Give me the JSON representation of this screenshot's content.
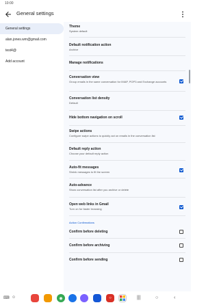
{
  "status_bar": {
    "time": "10:00"
  },
  "app_bar": {
    "title": "General settings"
  },
  "left_pane": {
    "items": [
      {
        "label": "General settings",
        "selected": true
      },
      {
        "label": "alan.jones.wm@gmail.com",
        "selected": false
      },
      {
        "label": "test4@",
        "selected": false
      },
      {
        "label": "Add account",
        "selected": false
      }
    ]
  },
  "settings": {
    "theme": {
      "title": "Theme",
      "sub": "System default"
    },
    "default_notification_action": {
      "title": "Default notification action",
      "sub": "Archive"
    },
    "manage_notifications": {
      "title": "Manage notifications"
    },
    "conversation_view": {
      "title": "Conversation view",
      "sub": "Group emails in the same conversation for IMAP, POP3 and Exchange accounts",
      "checked": true
    },
    "conversation_list_density": {
      "title": "Conversation list density",
      "sub": "Default"
    },
    "hide_bottom_navigation": {
      "title": "Hide bottom navigation on scroll",
      "checked": true
    },
    "swipe_actions": {
      "title": "Swipe actions",
      "sub": "Configure swipe actions to quickly act on emails in the conversation list"
    },
    "default_reply_action": {
      "title": "Default reply action",
      "sub": "Choose your default reply action"
    },
    "auto_fit_messages": {
      "title": "Auto-fit messages",
      "sub": "Shrink messages to fit the screen",
      "checked": true
    },
    "auto_advance": {
      "title": "Auto-advance",
      "sub": "Show conversation list after you archive or delete"
    },
    "open_web_links": {
      "title": "Open web links in Gmail",
      "sub": "Turn on for faster browsing",
      "checked": true
    },
    "section_action_confirmations": "Action Confirmations",
    "confirm_before_deleting": {
      "title": "Confirm before deleting",
      "checked": false
    },
    "confirm_before_archiving": {
      "title": "Confirm before archiving",
      "checked": false
    },
    "confirm_before_sending": {
      "title": "Confirm before sending",
      "checked": false
    }
  },
  "dock": {
    "icons": [
      "phone-app-icon",
      "messages-app-icon",
      "camera-app-icon",
      "gallery-app-icon",
      "whatsapp-app-icon",
      "chat-app-icon",
      "browser-app-icon",
      "clock-app-icon",
      "settings-app-icon",
      "apps-grid-icon"
    ]
  },
  "colors": {
    "accent": "#0b57d0",
    "selected_bg": "#e8eef9",
    "pane_bg": "#f7f9fd"
  }
}
